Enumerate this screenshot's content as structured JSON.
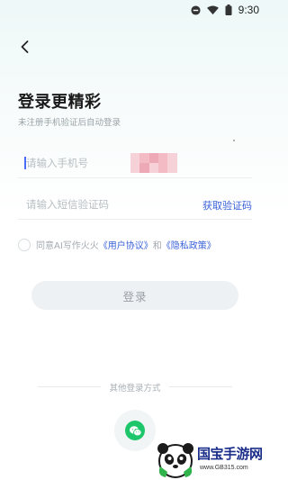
{
  "status_bar": {
    "time": "9:30"
  },
  "header": {
    "title": "登录更精彩",
    "subtitle": "未注册手机验证后自动登录"
  },
  "form": {
    "phone_placeholder": "请输入手机号",
    "code_placeholder": "请输入短信验证码",
    "get_code_label": "获取验证码"
  },
  "agreement": {
    "prefix": "同意AI写作火火",
    "user_agreement": "《用户协议》",
    "and": "和",
    "privacy_policy": "《隐私政策》"
  },
  "login_button": "登录",
  "other_login": {
    "label": "其他登录方式",
    "icon": "wechat-icon"
  },
  "watermark": {
    "text": "国宝手游网",
    "url": "www.GB315.com"
  },
  "colors": {
    "link": "#3a62d8",
    "wechat": "#1ec66b",
    "background_top": "#eef8f8"
  }
}
